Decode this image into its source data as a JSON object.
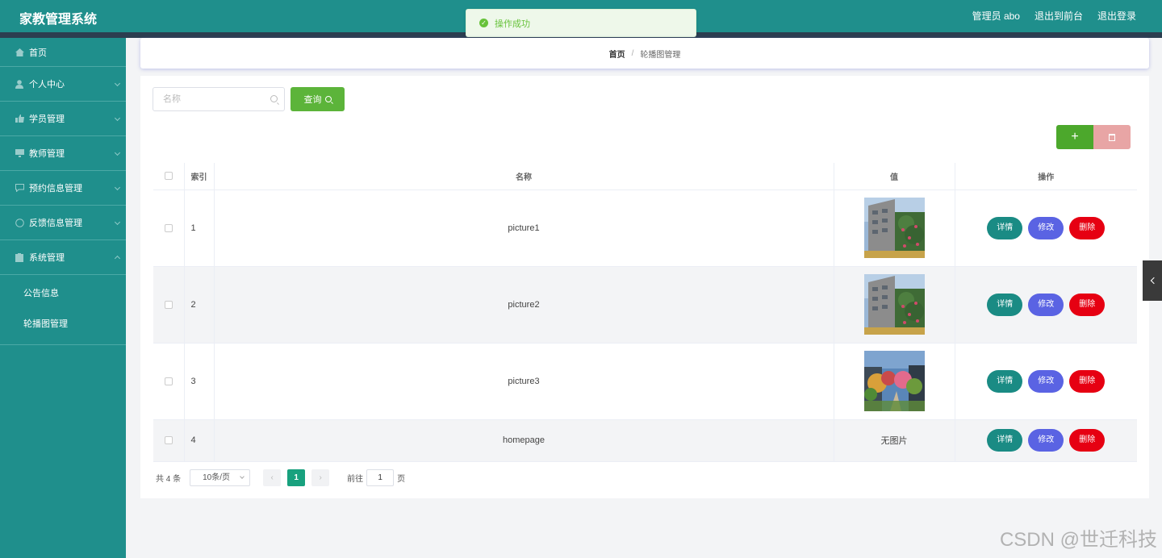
{
  "header": {
    "app_title": "家教管理系统",
    "links": [
      "管理员 abo",
      "退出到前台",
      "退出登录"
    ]
  },
  "toast": {
    "message": "操作成功",
    "color": "#67c23a"
  },
  "sidebar": {
    "items": [
      {
        "label": "首页",
        "icon": "home-icon",
        "has_arrow": false
      },
      {
        "label": "个人中心",
        "icon": "user-icon",
        "has_arrow": true
      },
      {
        "label": "学员管理",
        "icon": "thumb-icon",
        "has_arrow": true
      },
      {
        "label": "教师管理",
        "icon": "monitor-icon",
        "has_arrow": true
      },
      {
        "label": "预约信息管理",
        "icon": "chat-icon",
        "has_arrow": true
      },
      {
        "label": "反馈信息管理",
        "icon": "circle-icon",
        "has_arrow": true
      },
      {
        "label": "系统管理",
        "icon": "clipboard-icon",
        "has_arrow": true,
        "expanded": true
      }
    ],
    "sub_items": [
      "公告信息",
      "轮播图管理"
    ]
  },
  "breadcrumb": {
    "home": "首页",
    "separator": "/",
    "current": "轮播图管理"
  },
  "search": {
    "placeholder": "名称",
    "value": "",
    "query_label": "查询"
  },
  "actions": {
    "add_label": "+",
    "add_color": "#4ca82c",
    "delete_color": "#e8a5a5"
  },
  "table": {
    "headers": {
      "index": "索引",
      "name": "名称",
      "value": "值",
      "ops": "操作"
    },
    "rows": [
      {
        "index": "1",
        "name": "picture1",
        "image": "building"
      },
      {
        "index": "2",
        "name": "picture2",
        "image": "building"
      },
      {
        "index": "3",
        "name": "picture3",
        "image": "garden"
      },
      {
        "index": "4",
        "name": "homepage",
        "value_text": "无图片"
      }
    ],
    "op_labels": {
      "detail": "详情",
      "edit": "修改",
      "delete": "删除"
    }
  },
  "pagination": {
    "total": "共 4 条",
    "page_size": "10条/页",
    "current_page": "1",
    "goto_label": "前往",
    "goto_value": "1",
    "page_unit": "页"
  },
  "watermark": "CSDN @世迁科技",
  "colors": {
    "primary": "#1f8f8c",
    "header_strip": "#2c3e50",
    "detail": "#1a8b84",
    "edit": "#5a63e3",
    "delete": "#e60012",
    "active_page": "#18a17e"
  }
}
